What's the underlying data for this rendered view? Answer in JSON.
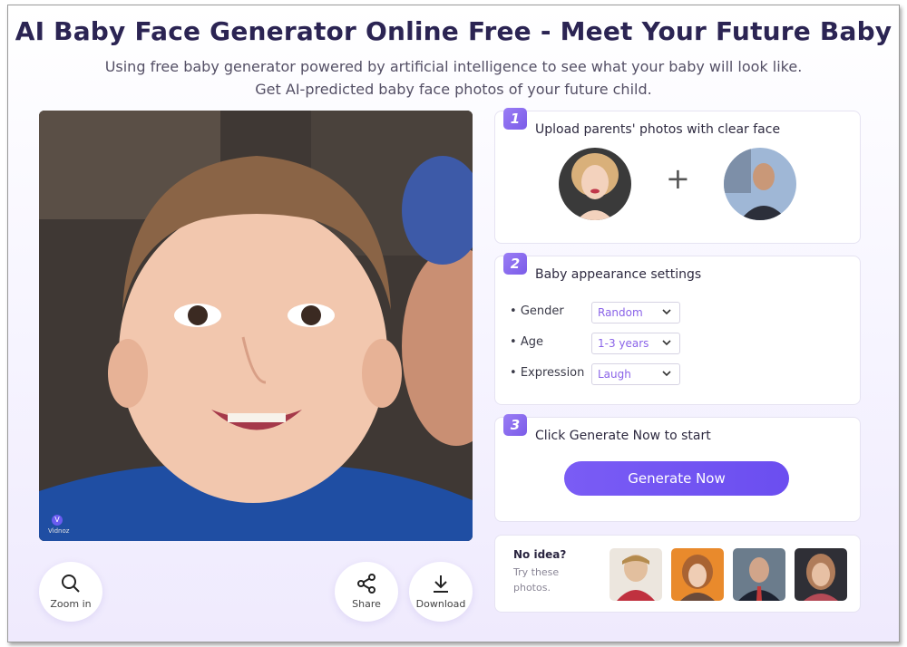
{
  "header": {
    "title": "AI Baby Face Generator Online Free - Meet Your Future Baby",
    "subtitle_line1": "Using free baby generator powered by artificial intelligence to see what your baby will look like.",
    "subtitle_line2": "Get AI-predicted baby face photos of your future child."
  },
  "preview": {
    "watermark": "Vidnoz",
    "watermark_initial": "V"
  },
  "tools": {
    "zoom_label": "Zoom in",
    "share_label": "Share",
    "download_label": "Download"
  },
  "step1": {
    "number": "1",
    "title": "Upload parents' photos with clear face",
    "plus": "+"
  },
  "step2": {
    "number": "2",
    "title": "Baby appearance settings",
    "settings": [
      {
        "label": "Gender",
        "value": "Random"
      },
      {
        "label": "Age",
        "value": "1-3 years"
      },
      {
        "label": "Expression",
        "value": "Laugh"
      }
    ]
  },
  "step3": {
    "number": "3",
    "title": "Click Generate Now to start",
    "button": "Generate Now"
  },
  "suggestions": {
    "title": "No idea?",
    "sub1": "Try these",
    "sub2": "photos."
  },
  "colors": {
    "accent": "#7a5cf5",
    "title": "#2b2453",
    "select_text": "#8a63e8"
  },
  "icons": [
    "zoom-icon",
    "share-icon",
    "download-icon",
    "chevron-down-icon",
    "plus-icon"
  ]
}
